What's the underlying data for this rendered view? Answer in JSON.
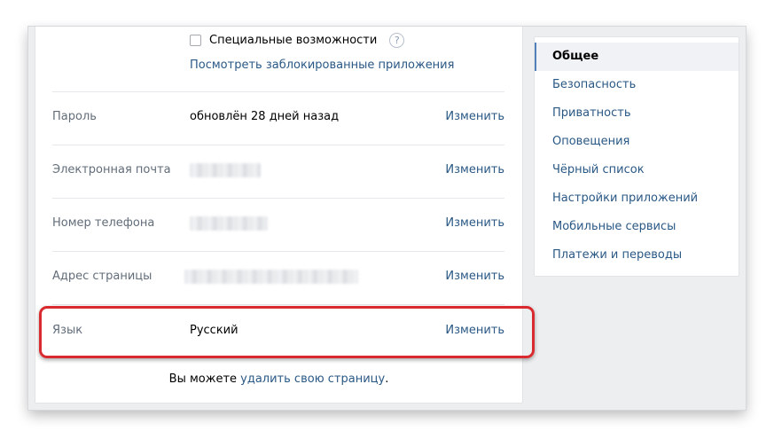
{
  "top": {
    "accessibility_label": "Специальные возможности",
    "help_symbol": "?",
    "blocked_apps_link": "Посмотреть заблокированные приложения"
  },
  "rows": [
    {
      "label": "Пароль",
      "value": "обновлён 28 дней назад",
      "action": "Изменить"
    },
    {
      "label": "Электронная почта",
      "value": "",
      "action": "Изменить"
    },
    {
      "label": "Номер телефона",
      "value": "",
      "action": "Изменить"
    },
    {
      "label": "Адрес страницы",
      "value": "",
      "action": "Изменить"
    },
    {
      "label": "Язык",
      "value": "Русский",
      "action": "Изменить"
    }
  ],
  "footer": {
    "prefix": "Вы можете",
    "delete_link": "удалить свою страницу",
    "suffix": "."
  },
  "menu": {
    "items": [
      "Общее",
      "Безопасность",
      "Приватность",
      "Оповещения",
      "Чёрный список",
      "Настройки приложений",
      "Мобильные сервисы",
      "Платежи и переводы"
    ],
    "active_index": 0
  },
  "colors": {
    "link": "#2a5885",
    "highlight": "#d92b2f",
    "label": "#626d7a"
  }
}
